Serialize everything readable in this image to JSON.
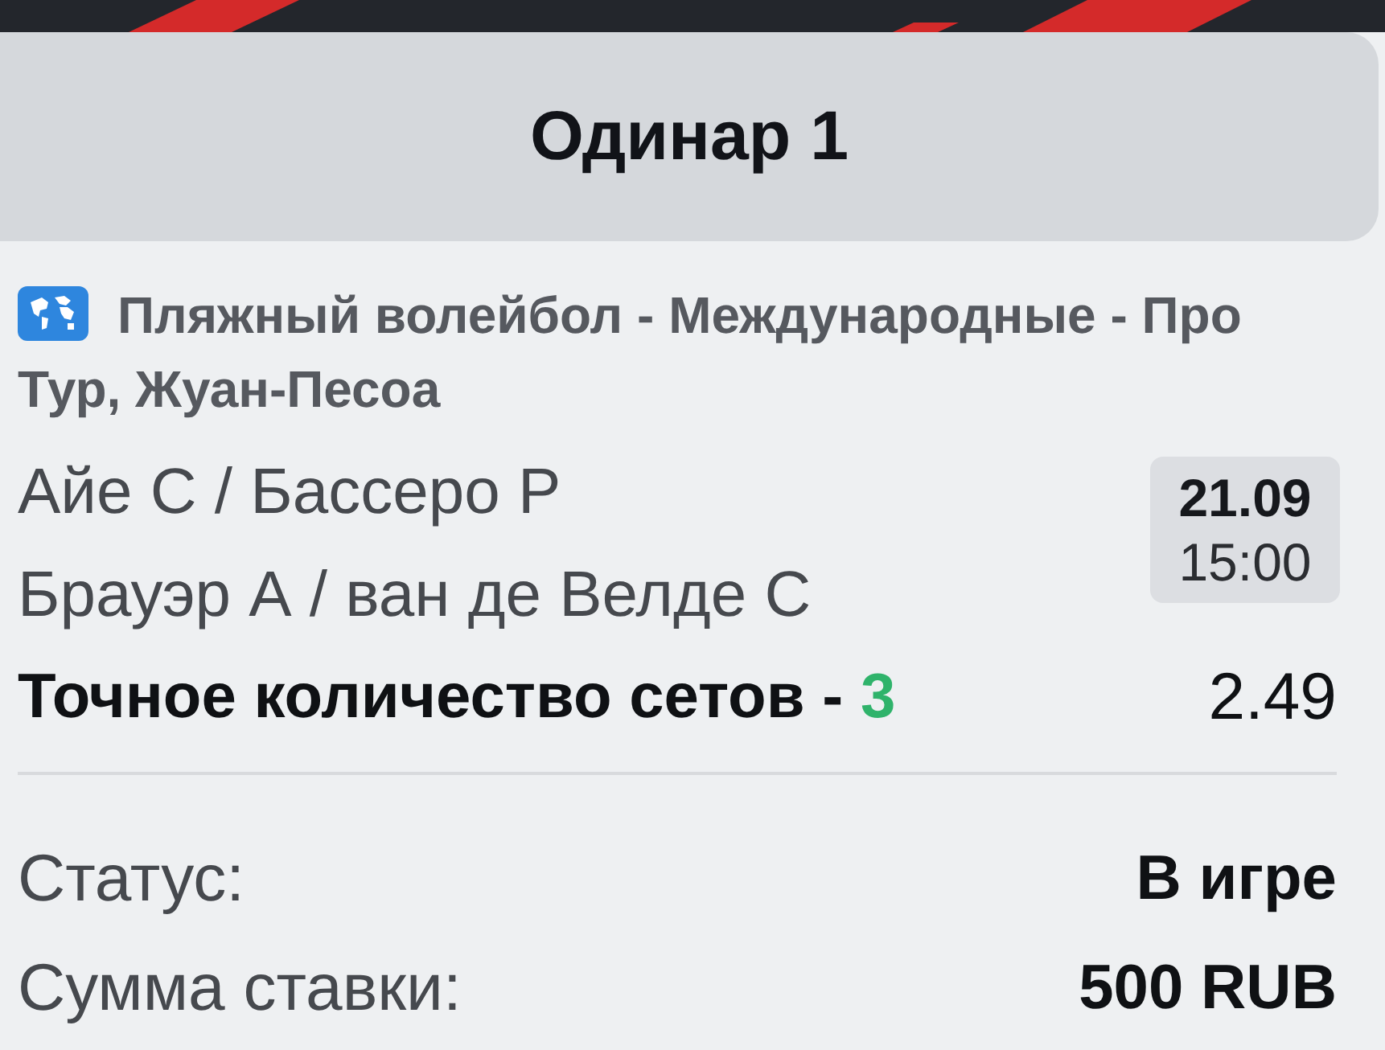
{
  "header": {
    "title": "Одинар 1"
  },
  "event": {
    "tournament": "Пляжный волейбол - Международные - Про Тур, Жуан-Песоа",
    "teams": [
      "Айе С / Бассеро Р",
      "Брауэр А / ван де Велде С"
    ],
    "date": "21.09",
    "time": "15:00"
  },
  "selection": {
    "market": "Точное количество сетов - ",
    "outcome": "3",
    "odds": "2.49"
  },
  "details": [
    {
      "label": "Статус:",
      "value": "В игре"
    },
    {
      "label": "Сумма ставки:",
      "value": "500 RUB"
    }
  ]
}
